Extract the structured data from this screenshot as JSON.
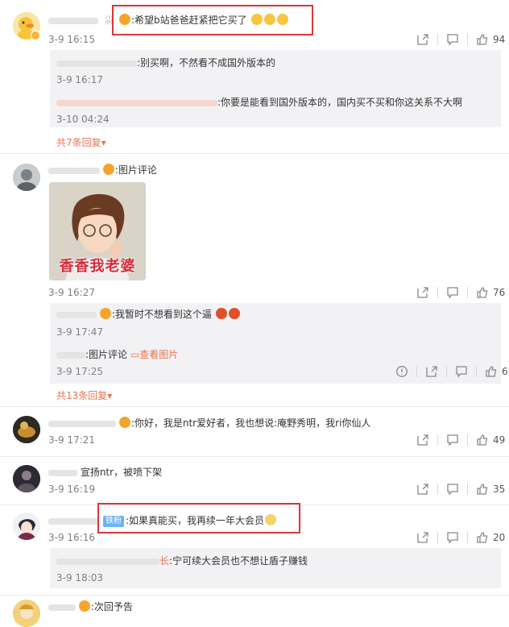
{
  "c1": {
    "text": ":希望b站爸爸赶紧把它买了",
    "time": "3-9 16:15",
    "likes": "94"
  },
  "r1a": {
    "text": ":别买啊，不然看不成国外版本的",
    "time": "3-9 16:17"
  },
  "r1b": {
    "text": ":你要是能看到国外版本的，国内买不买和你这关系不大啊",
    "time": "3-10 04:24"
  },
  "more1": "共7条回复",
  "c2": {
    "text": ":图片评论",
    "time": "3-9 16:27",
    "likes": "76",
    "image_caption": "香香我老婆"
  },
  "r2a": {
    "text": ":我暂时不想看到这个逼",
    "time": "3-9 17:47"
  },
  "r2b": {
    "text": ":图片评论",
    "link": "查看图片",
    "time": "3-9 17:25",
    "likes": "6"
  },
  "more2": "共13条回复",
  "c3": {
    "text": ":你好，我是ntr爱好者，我也想说:庵野秀明，我ri你仙人",
    "time": "3-9 17:21",
    "likes": "49"
  },
  "c4": {
    "text": "宣扬ntr，被喷下架",
    "time": "3-9 16:19",
    "likes": "35"
  },
  "c5": {
    "badge": "铁粉",
    "text": ":如果真能买，我再续一年大会员",
    "time": "3-9 16:16",
    "likes": "20"
  },
  "r5a": {
    "text": ":宁可续大会员也不想让盾子赚钱",
    "time": "3-9 18:03"
  },
  "c6": {
    "text": ":次回予告"
  },
  "colors": {
    "accent": "#eb7350",
    "highlight_box": "#d9373a",
    "time": "#808080"
  }
}
